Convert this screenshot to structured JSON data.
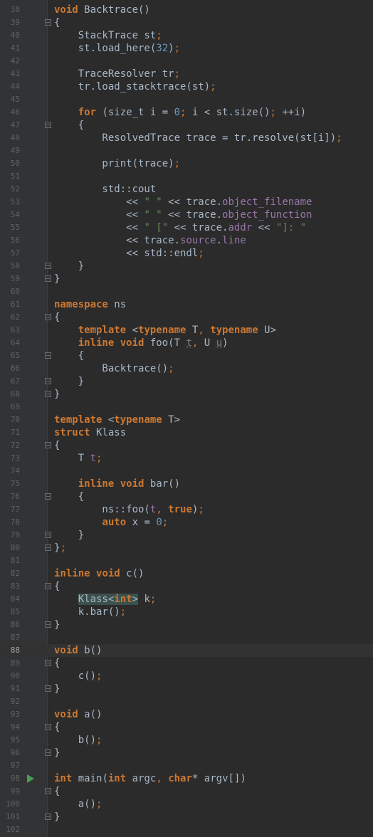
{
  "editor": {
    "lines": [
      {
        "n": "38",
        "html": "<span class=\"kw\">void</span> Backtrace()"
      },
      {
        "n": "39",
        "html": "{"
      },
      {
        "n": "40",
        "html": "    StackTrace st<span class=\"pn\">;</span>"
      },
      {
        "n": "41",
        "html": "    st.load_here(<span class=\"num\">32</span>)<span class=\"pn\">;</span>"
      },
      {
        "n": "42",
        "html": ""
      },
      {
        "n": "43",
        "html": "    TraceResolver tr<span class=\"pn\">;</span>"
      },
      {
        "n": "44",
        "html": "    tr.load_stacktrace(st)<span class=\"pn\">;</span>"
      },
      {
        "n": "45",
        "html": ""
      },
      {
        "n": "46",
        "html": "    <span class=\"kw\">for</span> (size_t i = <span class=\"num\">0</span><span class=\"pn\">;</span> i &lt; st.size()<span class=\"pn\">;</span> ++i)"
      },
      {
        "n": "47",
        "html": "    {"
      },
      {
        "n": "48",
        "html": "        ResolvedTrace trace = tr.resolve(st[i])<span class=\"pn\">;</span>"
      },
      {
        "n": "49",
        "html": ""
      },
      {
        "n": "50",
        "html": "        print(trace)<span class=\"pn\">;</span>"
      },
      {
        "n": "51",
        "html": ""
      },
      {
        "n": "52",
        "html": "        std::cout"
      },
      {
        "n": "53",
        "html": "            &lt;&lt; <span class=\"str\">\" \"</span> &lt;&lt; trace.<span class=\"fld\">object_filename</span>"
      },
      {
        "n": "54",
        "html": "            &lt;&lt; <span class=\"str\">\" \"</span> &lt;&lt; trace.<span class=\"fld\">object_function</span>"
      },
      {
        "n": "55",
        "html": "            &lt;&lt; <span class=\"str\">\" [\"</span> &lt;&lt; trace.<span class=\"fld\">addr</span> &lt;&lt; <span class=\"str\">\"]: \"</span>"
      },
      {
        "n": "56",
        "html": "            &lt;&lt; trace.<span class=\"fld\">source</span>.<span class=\"fld\">line</span>"
      },
      {
        "n": "57",
        "html": "            &lt;&lt; std::endl<span class=\"pn\">;</span>"
      },
      {
        "n": "58",
        "html": "    }"
      },
      {
        "n": "59",
        "html": "}"
      },
      {
        "n": "60",
        "html": ""
      },
      {
        "n": "61",
        "html": "<span class=\"kw\">namespace</span> ns"
      },
      {
        "n": "62",
        "html": "{"
      },
      {
        "n": "63",
        "html": "    <span class=\"kw\">template</span> &lt;<span class=\"kw\">typename</span> T<span class=\"pn\">,</span> <span class=\"kw\">typename</span> U&gt;"
      },
      {
        "n": "64",
        "html": "    <span class=\"kw\">inline</span> <span class=\"kw\">void</span> foo(T <span class=\"unused\">t</span><span class=\"pn\">,</span> U <span class=\"unused\">u</span>)"
      },
      {
        "n": "65",
        "html": "    {"
      },
      {
        "n": "66",
        "html": "        Backtrace()<span class=\"pn\">;</span>"
      },
      {
        "n": "67",
        "html": "    }"
      },
      {
        "n": "68",
        "html": "}"
      },
      {
        "n": "69",
        "html": ""
      },
      {
        "n": "70",
        "html": "<span class=\"kw\">template</span> &lt;<span class=\"kw\">typename</span> T&gt;"
      },
      {
        "n": "71",
        "html": "<span class=\"kw\">struct</span> Klass"
      },
      {
        "n": "72",
        "html": "{"
      },
      {
        "n": "73",
        "html": "    T <span class=\"fld\">t</span><span class=\"pn\">;</span>"
      },
      {
        "n": "74",
        "html": ""
      },
      {
        "n": "75",
        "html": "    <span class=\"kw\">inline</span> <span class=\"kw\">void</span> bar()"
      },
      {
        "n": "76",
        "html": "    {"
      },
      {
        "n": "77",
        "html": "        ns::foo(<span class=\"fld\">t</span><span class=\"pn\">,</span> <span class=\"kw\">true</span>)<span class=\"pn\">;</span>"
      },
      {
        "n": "78",
        "html": "        <span class=\"kw\">auto</span> x = <span class=\"num\">0</span><span class=\"pn\">;</span>"
      },
      {
        "n": "79",
        "html": "    }"
      },
      {
        "n": "80",
        "html": "}<span class=\"pn\">;</span>"
      },
      {
        "n": "81",
        "html": ""
      },
      {
        "n": "82",
        "html": "<span class=\"kw\">inline</span> <span class=\"kw\">void</span> c()"
      },
      {
        "n": "83",
        "html": "{"
      },
      {
        "n": "84",
        "html": "    <span class=\"hl\">Klass&lt;<span class=\"kw\">int</span>&gt;</span> k<span class=\"pn\">;</span>"
      },
      {
        "n": "85",
        "html": "    k.bar()<span class=\"pn\">;</span>"
      },
      {
        "n": "86",
        "html": "}"
      },
      {
        "n": "87",
        "html": ""
      },
      {
        "n": "88",
        "html": "<span class=\"kw\">void</span> b()"
      },
      {
        "n": "89",
        "html": "{"
      },
      {
        "n": "90",
        "html": "    c()<span class=\"pn\">;</span>"
      },
      {
        "n": "91",
        "html": "}"
      },
      {
        "n": "92",
        "html": ""
      },
      {
        "n": "93",
        "html": "<span class=\"kw\">void</span> a()"
      },
      {
        "n": "94",
        "html": "{"
      },
      {
        "n": "95",
        "html": "    b()<span class=\"pn\">;</span>"
      },
      {
        "n": "96",
        "html": "}"
      },
      {
        "n": "97",
        "html": ""
      },
      {
        "n": "98",
        "html": "<span class=\"kw\">int</span> main(<span class=\"kw\">int</span> argc<span class=\"pn\">,</span> <span class=\"kw\">char</span>* argv[])"
      },
      {
        "n": "99",
        "html": "{"
      },
      {
        "n": "100",
        "html": "    a()<span class=\"pn\">;</span>"
      },
      {
        "n": "101",
        "html": "}"
      },
      {
        "n": "102",
        "html": ""
      }
    ],
    "current_line": "88",
    "run_line": "98",
    "fold_open": [
      "39",
      "47",
      "62",
      "65",
      "72",
      "76",
      "83",
      "89",
      "94",
      "99"
    ],
    "fold_close": [
      "58",
      "59",
      "67",
      "68",
      "79",
      "80",
      "86",
      "91",
      "96",
      "101"
    ],
    "colors": {
      "background": "#2b2b2b",
      "keyword": "#cc7832",
      "number": "#6897bb",
      "string": "#6a8759",
      "field": "#9876aa",
      "text": "#a9b7c6"
    }
  }
}
